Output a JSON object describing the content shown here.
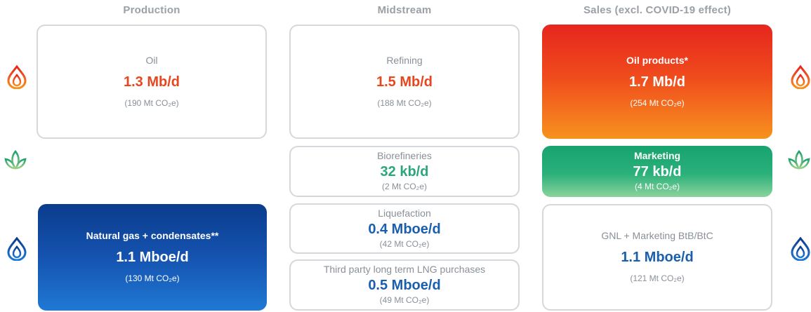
{
  "columns": {
    "production": "Production",
    "midstream": "Midstream",
    "sales": "Sales (excl. COVID-19 effect)"
  },
  "cards": {
    "oil": {
      "label": "Oil",
      "value": "1.3 Mb/d",
      "emissions": "(190 Mt CO₂e)"
    },
    "natgas": {
      "label": "Natural gas + condensates**",
      "value": "1.1 Mboe/d",
      "emissions": "(130 Mt CO₂e)"
    },
    "refining": {
      "label": "Refining",
      "value": "1.5 Mb/d",
      "emissions": "(188 Mt CO₂e)"
    },
    "biorefineries": {
      "label": "Biorefineries",
      "value": "32 kb/d",
      "emissions": "(2 Mt CO₂e)"
    },
    "liquefaction": {
      "label": "Liquefaction",
      "value": "0.4 Mboe/d",
      "emissions": "(42 Mt CO₂e)"
    },
    "lng_purchases": {
      "label": "Third party long term LNG purchases",
      "value": "0.5 Mboe/d",
      "emissions": "(49 Mt CO₂e)"
    },
    "oil_products": {
      "label": "Oil products*",
      "value": "1.7 Mb/d",
      "emissions": "(254 Mt CO₂e)"
    },
    "marketing": {
      "label": "Marketing",
      "value": "77 kb/d",
      "emissions": "(4 Mt CO₂e)"
    },
    "gnl_marketing": {
      "label": "GNL + Marketing BtB/BtC",
      "value": "1.1 Mboe/d",
      "emissions": "(121 Mt CO₂e)"
    }
  },
  "colors": {
    "oil_red": "#e8461e",
    "bio_green": "#2ba57a",
    "gas_blue": "#1a5fae",
    "border_gray": "#d4d8dc",
    "header_gray": "#9aa0a6"
  },
  "icons": {
    "oil_row": "oil-drop-flame-icon",
    "bio_row": "leaf-lotus-icon",
    "gas_row": "gas-drop-flame-icon"
  }
}
